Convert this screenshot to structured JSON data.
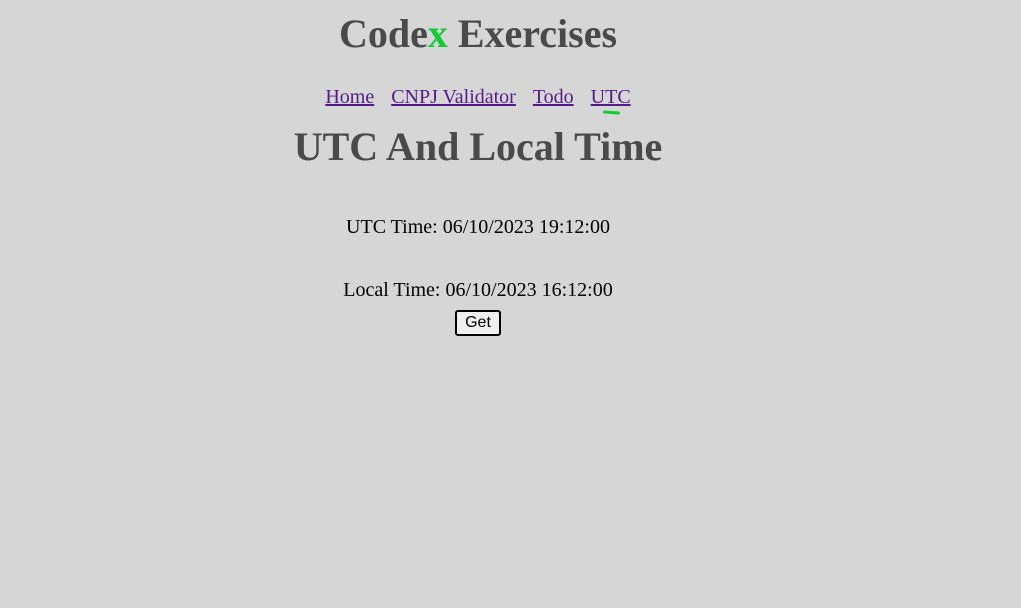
{
  "header": {
    "brand_prefix": "Code",
    "brand_accent": "x",
    "brand_suffix": " Exercises",
    "accent_color": "#11cc33"
  },
  "nav": {
    "items": [
      {
        "label": "Home"
      },
      {
        "label": "CNPJ Validator"
      },
      {
        "label": "Todo"
      },
      {
        "label": "UTC",
        "active": true
      }
    ]
  },
  "main": {
    "title": "UTC And Local Time",
    "utc_time": "UTC Time: 06/10/2023 19:12:00",
    "local_time": "Local Time: 06/10/2023 16:12:00",
    "get_label": "Get"
  }
}
